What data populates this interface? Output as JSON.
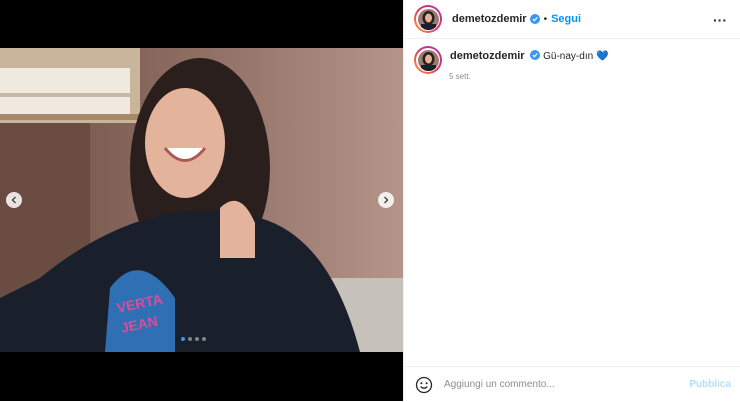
{
  "post": {
    "username": "demetozdemir",
    "separator": "•",
    "follow_label": "Segui",
    "more_label": "···",
    "caption_username": "demetozdemir",
    "caption_text": "Gü-nay-dın",
    "caption_emoji": "💙",
    "timestamp": "5 sett."
  },
  "carousel": {
    "slide_count": 4,
    "current_slide": 1
  },
  "comment": {
    "placeholder": "Aggiungi un commento...",
    "publish_label": "Pubblica"
  },
  "colors": {
    "accent": "#0095f6",
    "verified": "#3897f0",
    "publish_disabled": "#b2dffc"
  },
  "icons": [
    "chevron-left-icon",
    "chevron-right-icon",
    "verified-badge-icon",
    "emoji-icon",
    "more-options-icon"
  ]
}
